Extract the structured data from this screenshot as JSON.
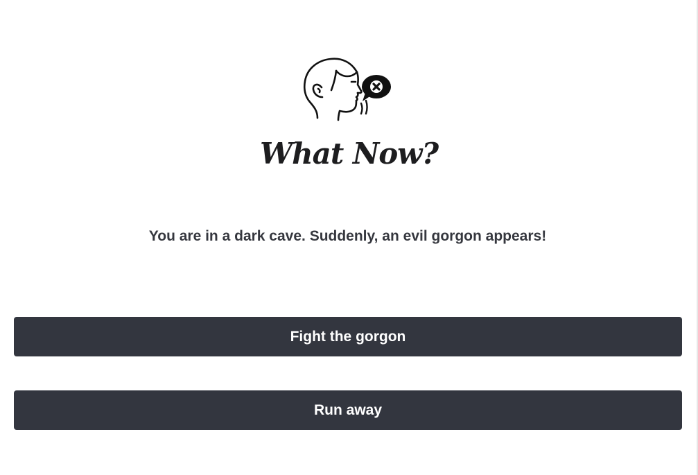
{
  "app": {
    "title": "What Now?",
    "logo_icon": "talking-head-icon",
    "speech_icon": "speech-bubble-x-icon"
  },
  "story": {
    "text": "You are in a dark cave. Suddenly, an evil gorgon appears!"
  },
  "choices": [
    {
      "label": "Fight the gorgon"
    },
    {
      "label": "Run away"
    }
  ],
  "colors": {
    "background": "#ffffff",
    "button": "#33363f",
    "button_text": "#ffffff",
    "text": "#35373e"
  }
}
